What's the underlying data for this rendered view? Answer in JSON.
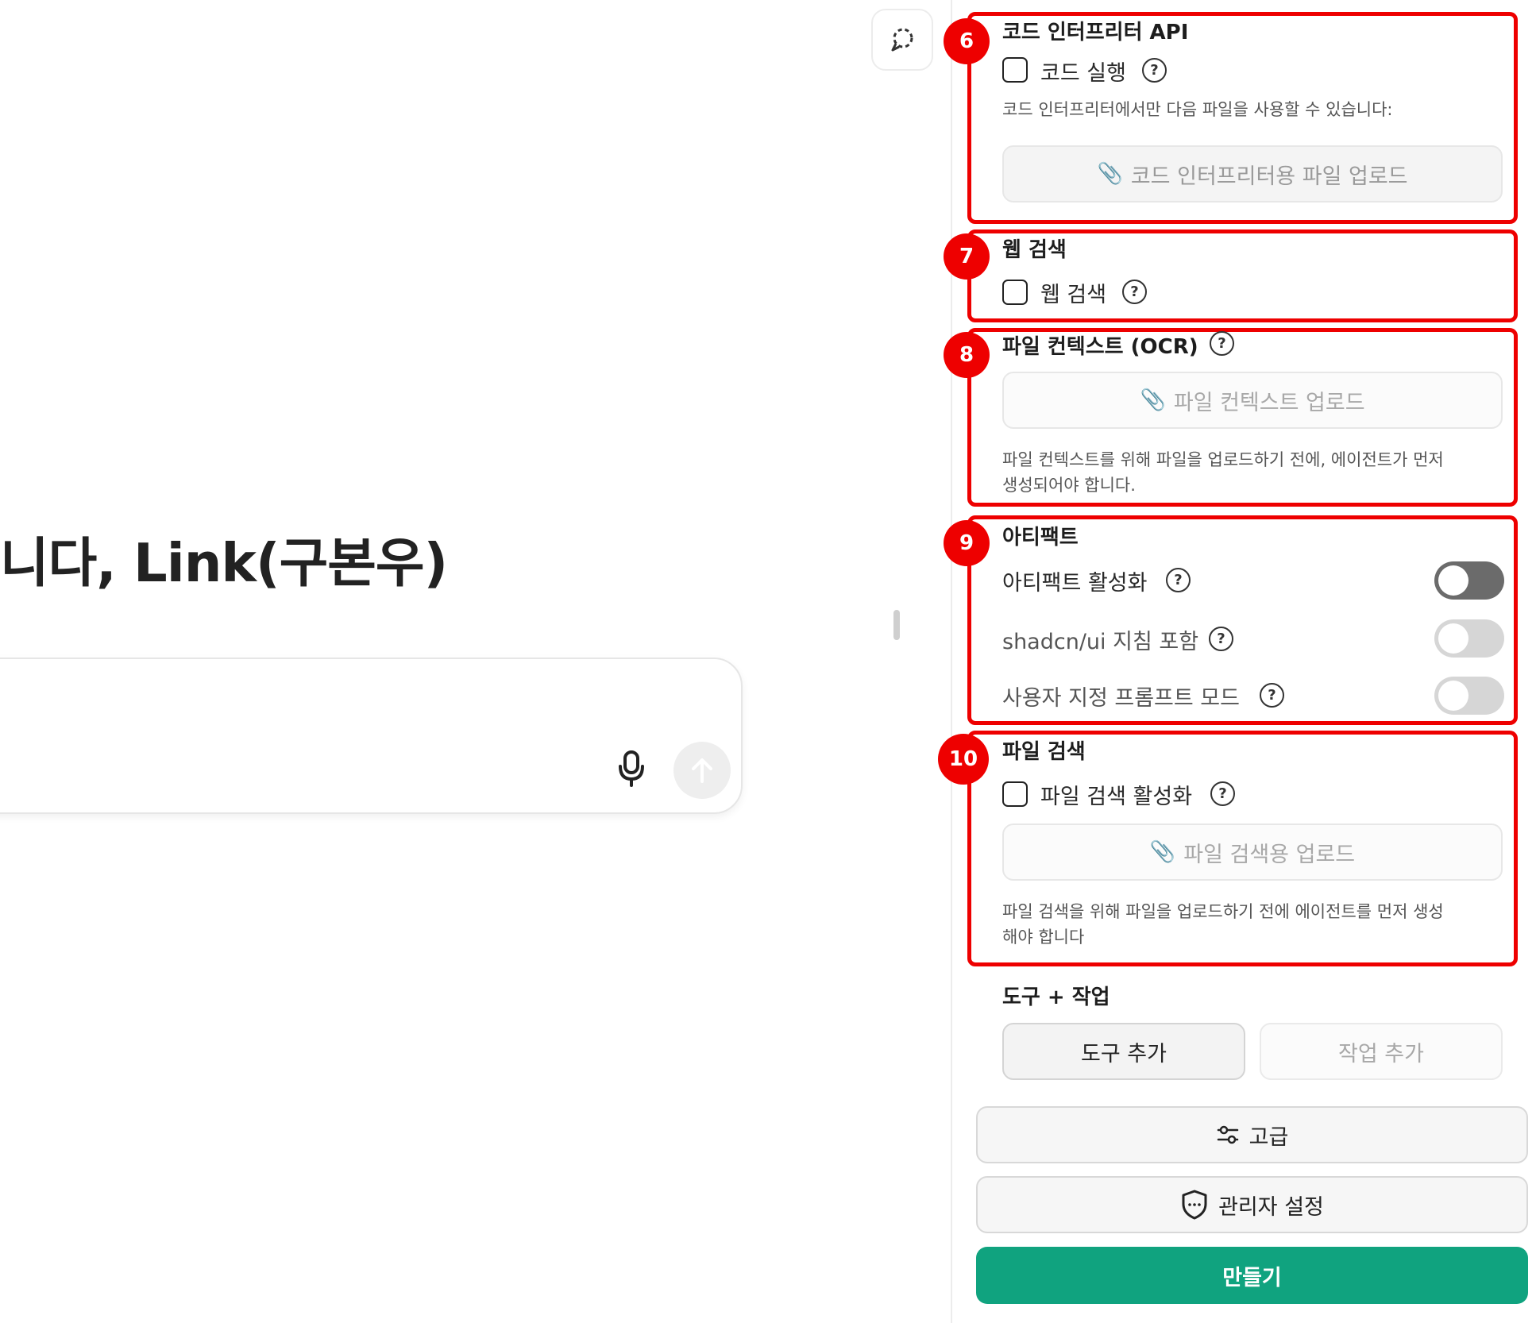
{
  "chat": {
    "welcome_text": "니다, Link(구본우)"
  },
  "icons": {
    "chat_toggle": "chat-bubble-dashed-icon",
    "mic": "microphone-icon",
    "send": "arrow-up-icon",
    "help": "question-circle-icon",
    "clip": "paperclip-icon",
    "sliders": "sliders-icon",
    "shield": "shield-icon"
  },
  "code_interpreter": {
    "badge": "6",
    "title": "코드 인터프리터 API",
    "checkbox_label": "코드 실행",
    "note": "코드 인터프리터에서만 다음 파일을 사용할 수 있습니다:",
    "upload_label": "코드 인터프리터용 파일 업로드",
    "checked": false
  },
  "web_search": {
    "badge": "7",
    "title": "웹 검색",
    "checkbox_label": "웹 검색",
    "checked": false
  },
  "file_context": {
    "badge": "8",
    "title": "파일 컨텍스트 (OCR)",
    "upload_label": "파일 컨텍스트 업로드",
    "note_line1": "파일 컨텍스트를 위해 파일을 업로드하기 전에, 에이전트가 먼저",
    "note_line2": "생성되어야 합니다."
  },
  "artifacts": {
    "badge": "9",
    "title": "아티팩트",
    "toggles": [
      {
        "label": "아티팩트 활성화",
        "on": false
      },
      {
        "label": "shadcn/ui 지침 포함",
        "on": false
      },
      {
        "label": "사용자 지정 프롬프트 모드",
        "on": false
      }
    ]
  },
  "file_search": {
    "badge": "10",
    "title": "파일 검색",
    "checkbox_label": "파일 검색 활성화",
    "upload_label": "파일 검색용 업로드",
    "note_line1": "파일 검색을 위해 파일을 업로드하기 전에 에이전트를 먼저 생성",
    "note_line2": "해야 합니다",
    "checked": false
  },
  "tools_actions": {
    "title": "도구 + 작업",
    "add_tool": "도구 추가",
    "add_action": "작업 추가"
  },
  "footer": {
    "advanced": "고급",
    "admin_settings": "관리자 설정",
    "create": "만들기"
  },
  "colors": {
    "annotation_red": "#ee0000",
    "create_green": "#10a37f"
  }
}
